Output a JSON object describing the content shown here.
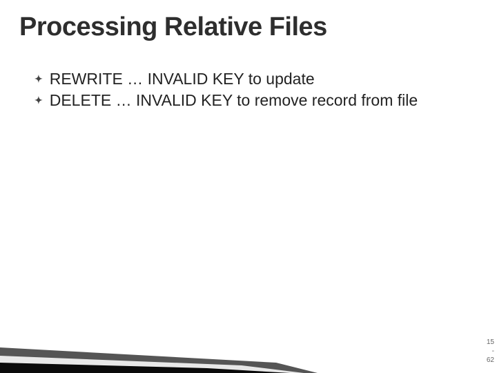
{
  "title": "Processing Relative Files",
  "bullets": [
    "REWRITE … INVALID KEY to update",
    "DELETE … INVALID KEY to remove record from file"
  ],
  "page": {
    "chapter": "15",
    "dash": "-",
    "num": "62"
  }
}
